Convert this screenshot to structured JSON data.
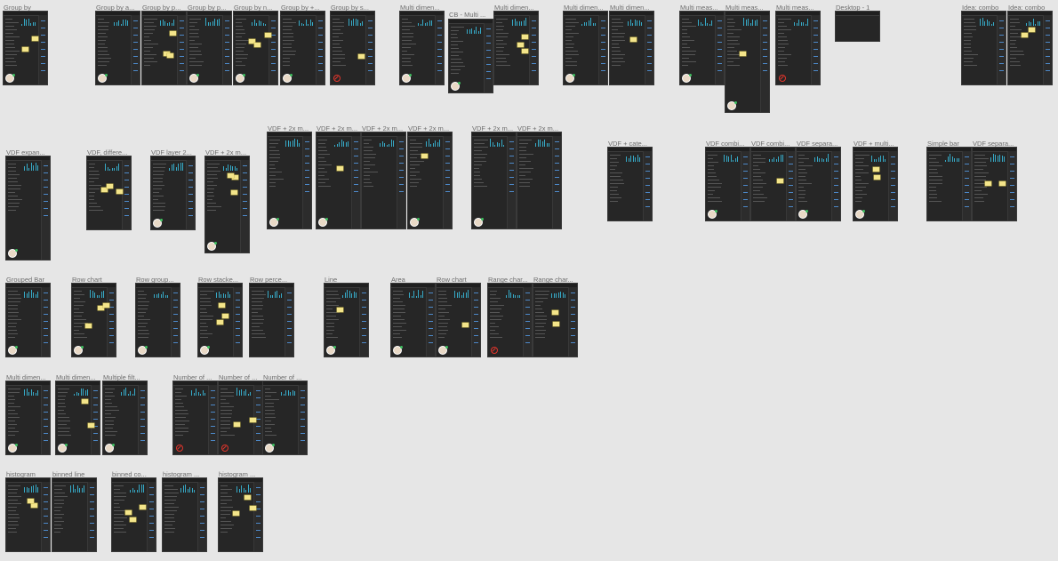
{
  "canvas": {
    "background": "#e6e6e6",
    "frame_color": "#262626",
    "accent": "#36a9c6",
    "sticky_color": "#f4e58a"
  },
  "boards": [
    {
      "label": "Group by"
    },
    {
      "label": "Group by a..."
    },
    {
      "label": "Group by p..."
    },
    {
      "label": "Group by p..."
    },
    {
      "label": "Group by n..."
    },
    {
      "label": "Group by +..."
    },
    {
      "label": "Group by s..."
    },
    {
      "label": "Multi dimen..."
    },
    {
      "label": "CB - Multi ..."
    },
    {
      "label": "Multi dimen..."
    },
    {
      "label": "Multi dimen..."
    },
    {
      "label": "Multi dimen..."
    },
    {
      "label": "Multi meas..."
    },
    {
      "label": "Multi meas..."
    },
    {
      "label": "Multi meas..."
    },
    {
      "label": "Desktop - 1"
    },
    {
      "label": "Idea: combo"
    },
    {
      "label": "Idea: combo"
    },
    {
      "label": "VDF expan..."
    },
    {
      "label": "VDF, differe..."
    },
    {
      "label": "VDF layer 2..."
    },
    {
      "label": "VDF + 2x m..."
    },
    {
      "label": "VDF + 2x m..."
    },
    {
      "label": "VDF + 2x m..."
    },
    {
      "label": "VDF + 2x m..."
    },
    {
      "label": "VDF + 2x m..."
    },
    {
      "label": "VDF + 2x m..."
    },
    {
      "label": "VDF + 2x m..."
    },
    {
      "label": "VDF + cate..."
    },
    {
      "label": "VDF combi..."
    },
    {
      "label": "VDF combi..."
    },
    {
      "label": "VDF separa..."
    },
    {
      "label": "VDF + multi..."
    },
    {
      "label": "Simple bar"
    },
    {
      "label": "VDF separa..."
    },
    {
      "label": "Grouped Bar"
    },
    {
      "label": "Row chart"
    },
    {
      "label": "Row group..."
    },
    {
      "label": "Row stacke..."
    },
    {
      "label": "Row perce..."
    },
    {
      "label": "Line"
    },
    {
      "label": "Area"
    },
    {
      "label": "Row chart"
    },
    {
      "label": "Range char..."
    },
    {
      "label": "Range char..."
    },
    {
      "label": "Multi dimen..."
    },
    {
      "label": "Multi dimen..."
    },
    {
      "label": "Multiple filt..."
    },
    {
      "label": "Number of ..."
    },
    {
      "label": "Number of ..."
    },
    {
      "label": "Number of ..."
    },
    {
      "label": "histogram"
    },
    {
      "label": "binned line"
    },
    {
      "label": "binned co..."
    },
    {
      "label": "histogram ..."
    },
    {
      "label": "histogram ..."
    }
  ]
}
